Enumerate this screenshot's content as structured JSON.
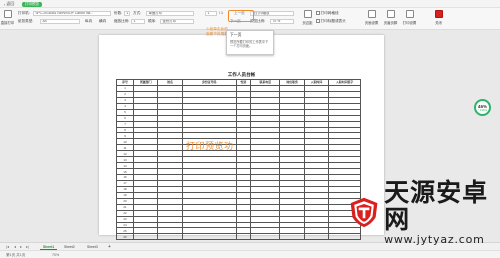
{
  "titlebar": {
    "back_label": "返回",
    "mode_badge": "打印预览"
  },
  "ribbon": {
    "printer_label": "打印机:",
    "printer_value": "\\\\PC-20180817WINV0OP Canon Ink...",
    "copies_label": "份数:",
    "copies_value": "1",
    "sides_label": "方式:",
    "sides_value": "单面打印",
    "order_label": "顺序:",
    "order_value": "逐份打印",
    "paper_type_label": "纸张类型:",
    "paper_type_value": "A4",
    "orient_portrait": "纵向",
    "orient_landscape": "横向",
    "scale_label": "缩放比例:",
    "scale_value": "1",
    "page_nav_value": "1",
    "page_nav_total": "/ 1",
    "prev_page_label": "上一页",
    "next_page_label": "下一页",
    "zoom_label": "预览比例:",
    "zoom_value": "70 %",
    "print_type_value": "无打印缩放",
    "margins_label": "页边距",
    "margins_value": "显示/隐藏",
    "print_grid_label": "打印网格线",
    "print_header_label": "打印标题或表头",
    "print_button": "直接打印",
    "page_setup": "页面设置",
    "header_footer": "页眉页脚",
    "print_preview_settings": "打印设置",
    "close_label": "关闭",
    "more_label": "更多设置"
  },
  "callout": {
    "line1": "5.就单击此的",
    "line2": "查看下页展报"
  },
  "tooltip": {
    "title": "下一页",
    "body": "预览所要打印的工作表中下一个打印页面。"
  },
  "document": {
    "title": "工作人员台帐",
    "columns": [
      "序号",
      "所属部门",
      "姓名",
      "身份证号码",
      "性别",
      "联系电话",
      "岗位职务",
      "入职时间",
      "入职时间签字"
    ],
    "row_numbers": [
      "1",
      "2",
      "3",
      "4",
      "5",
      "6",
      "7",
      "8",
      "9",
      "10",
      "11",
      "12",
      "13",
      "14",
      "15",
      "16",
      "17",
      "18",
      "19",
      "20",
      "21",
      "22",
      "23",
      "24",
      "25",
      "26"
    ],
    "watermark": "打印预览功"
  },
  "zoom_widget": {
    "percent": "46%",
    "sub": "↑ 0.2K/s"
  },
  "sheets": {
    "tabs": [
      "Sheet1",
      "Sheet2",
      "Sheet3"
    ],
    "add": "+"
  },
  "statusbar": {
    "page_info": "第1页 共1页",
    "zoom": "70%"
  },
  "logo": {
    "name": "天源安卓网",
    "url": "www.jytyaz.com"
  },
  "colors": {
    "accent_orange": "#f08c2a",
    "accent_green": "#1b8c3a",
    "brand_green": "#2fb36a",
    "logo_red": "#d9201f"
  }
}
